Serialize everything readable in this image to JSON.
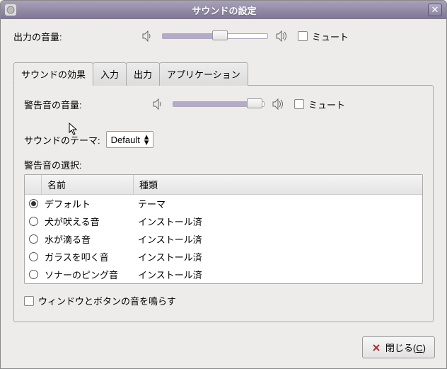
{
  "window": {
    "title": "サウンドの設定",
    "close_icon": "✕"
  },
  "output": {
    "label": "出力の音量:",
    "mute_label": "ミュート",
    "value_pct": 55,
    "mute_checked": false
  },
  "tabs": [
    {
      "label": "サウンドの効果",
      "active": true
    },
    {
      "label": "入力",
      "active": false
    },
    {
      "label": "出力",
      "active": false
    },
    {
      "label": "アプリケーション",
      "active": false
    }
  ],
  "alert": {
    "label": "警告音の音量:",
    "mute_label": "ミュート",
    "value_pct": 90,
    "mute_checked": false
  },
  "theme": {
    "label": "サウンドのテーマ:",
    "selected": "Default"
  },
  "selection": {
    "title": "警告音の選択:",
    "columns": {
      "name": "名前",
      "kind": "種類"
    },
    "rows": [
      {
        "name": "デフォルト",
        "kind": "テーマ",
        "selected": true
      },
      {
        "name": "犬が吠える音",
        "kind": "インストール済",
        "selected": false
      },
      {
        "name": "水が滴る音",
        "kind": "インストール済",
        "selected": false
      },
      {
        "name": "ガラスを叩く音",
        "kind": "インストール済",
        "selected": false
      },
      {
        "name": "ソナーのピング音",
        "kind": "インストール済",
        "selected": false
      }
    ]
  },
  "window_sounds": {
    "label": "ウィンドウとボタンの音を鳴らす",
    "checked": false
  },
  "footer": {
    "close_prefix": "閉じる(",
    "close_accel": "C",
    "close_suffix": ")"
  }
}
